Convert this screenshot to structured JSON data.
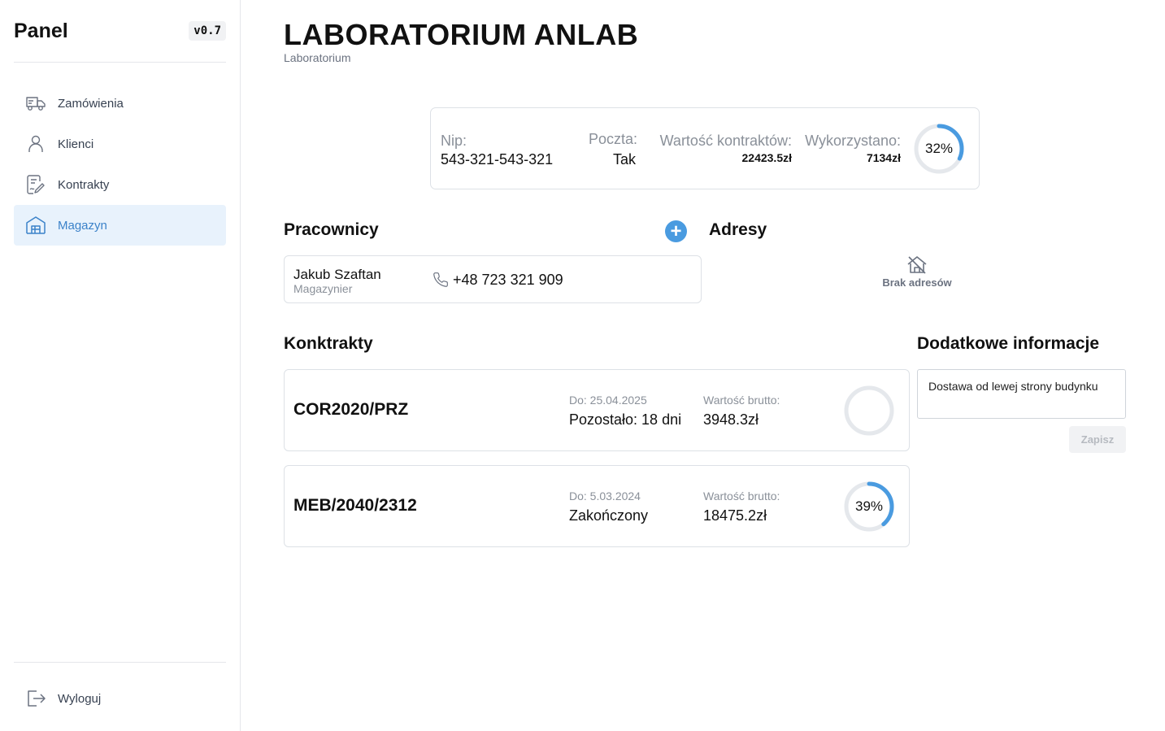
{
  "sidebar": {
    "brand": "Panel",
    "version": "v0.7",
    "items": [
      {
        "label": "Zamówienia",
        "icon": "truck-icon",
        "active": false
      },
      {
        "label": "Klienci",
        "icon": "user-icon",
        "active": false
      },
      {
        "label": "Kontrakty",
        "icon": "contract-icon",
        "active": false
      },
      {
        "label": "Magazyn",
        "icon": "warehouse-icon",
        "active": true
      }
    ],
    "logout": {
      "label": "Wyloguj",
      "icon": "logout-icon"
    }
  },
  "header": {
    "title": "LABORATORIUM ANLAB",
    "subtitle": "Laboratorium"
  },
  "stats": {
    "nip_label": "Nip:",
    "nip_value": "543-321-543-321",
    "poczta_label": "Poczta:",
    "poczta_value": "Tak",
    "wartosc_label": "Wartość kontraktów:",
    "wartosc_value": "22423.5zł",
    "wykorzystano_label": "Wykorzystano:",
    "wykorzystano_value": "7134zł",
    "usage_percent_label": "32%",
    "usage_fraction": 0.32
  },
  "workers": {
    "title": "Pracownicy",
    "add_label": "+",
    "items": [
      {
        "name": "Jakub Szaftan",
        "role": "Magazynier",
        "phone": "+48 723 321 909"
      }
    ]
  },
  "addresses": {
    "title": "Adresy",
    "empty_text": "Brak adresów",
    "icon": "no-home-icon"
  },
  "contracts": {
    "title": "Konktrakty",
    "items": [
      {
        "id": "COR2020/PRZ",
        "date": "Do: 25.04.2025",
        "status": "Pozostało: 18 dni",
        "value_label": "Wartość brutto:",
        "value": "3948.3zł",
        "progress_label": "",
        "progress_fraction": 0
      },
      {
        "id": "MEB/2040/2312",
        "date": "Do: 5.03.2024",
        "status": "Zakończony",
        "value_label": "Wartość brutto:",
        "value": "18475.2zł",
        "progress_label": "39%",
        "progress_fraction": 0.39
      }
    ]
  },
  "extra_info": {
    "title": "Dodatkowe informacje",
    "text": "Dostawa od lewej strony budynku",
    "save_label": "Zapisz"
  },
  "colors": {
    "accent": "#4a9be0",
    "ring_track": "#e5e8ec",
    "active_bg": "#e8f2fc"
  }
}
